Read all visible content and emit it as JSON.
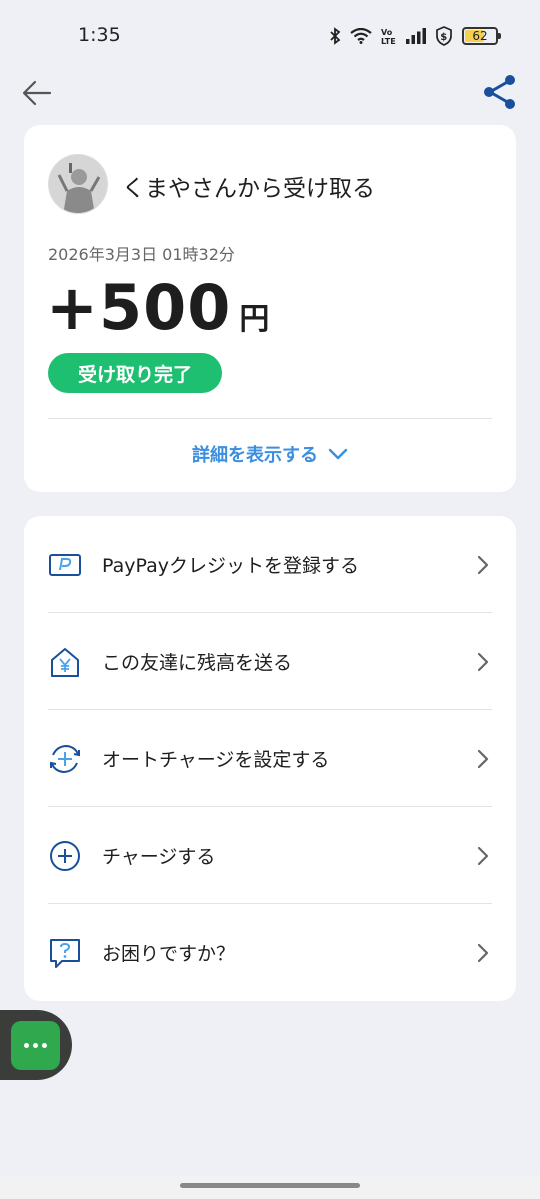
{
  "status_bar": {
    "time": "1:35",
    "battery": "62",
    "battery_level": 0.62,
    "icons": [
      "bluetooth-icon",
      "wifi-icon",
      "volte-icon",
      "signal-icon",
      "shield-dollar-icon",
      "battery-icon"
    ]
  },
  "nav": {
    "back_icon": "back-arrow-icon",
    "share_icon": "share-icon",
    "accent": "#1a4f9c"
  },
  "receipt": {
    "title": "くまやさんから受け取る",
    "datetime": "2026年3月3日 01時32分",
    "amount": "+500",
    "unit": "円",
    "status": "受け取り完了",
    "status_color": "#1fbf72",
    "details_link": "詳細を表示する"
  },
  "menu": {
    "items": [
      {
        "label": "PayPayクレジットを登録する",
        "icon": "paypay-card-icon"
      },
      {
        "label": "この友達に残高を送る",
        "icon": "house-yen-icon"
      },
      {
        "label": "オートチャージを設定する",
        "icon": "auto-charge-icon"
      },
      {
        "label": "チャージする",
        "icon": "plus-circle-icon"
      },
      {
        "label": "お困りですか？",
        "icon": "help-chat-icon"
      }
    ]
  },
  "floating": {
    "icon": "more-dots-icon",
    "color": "#2fa84e"
  }
}
